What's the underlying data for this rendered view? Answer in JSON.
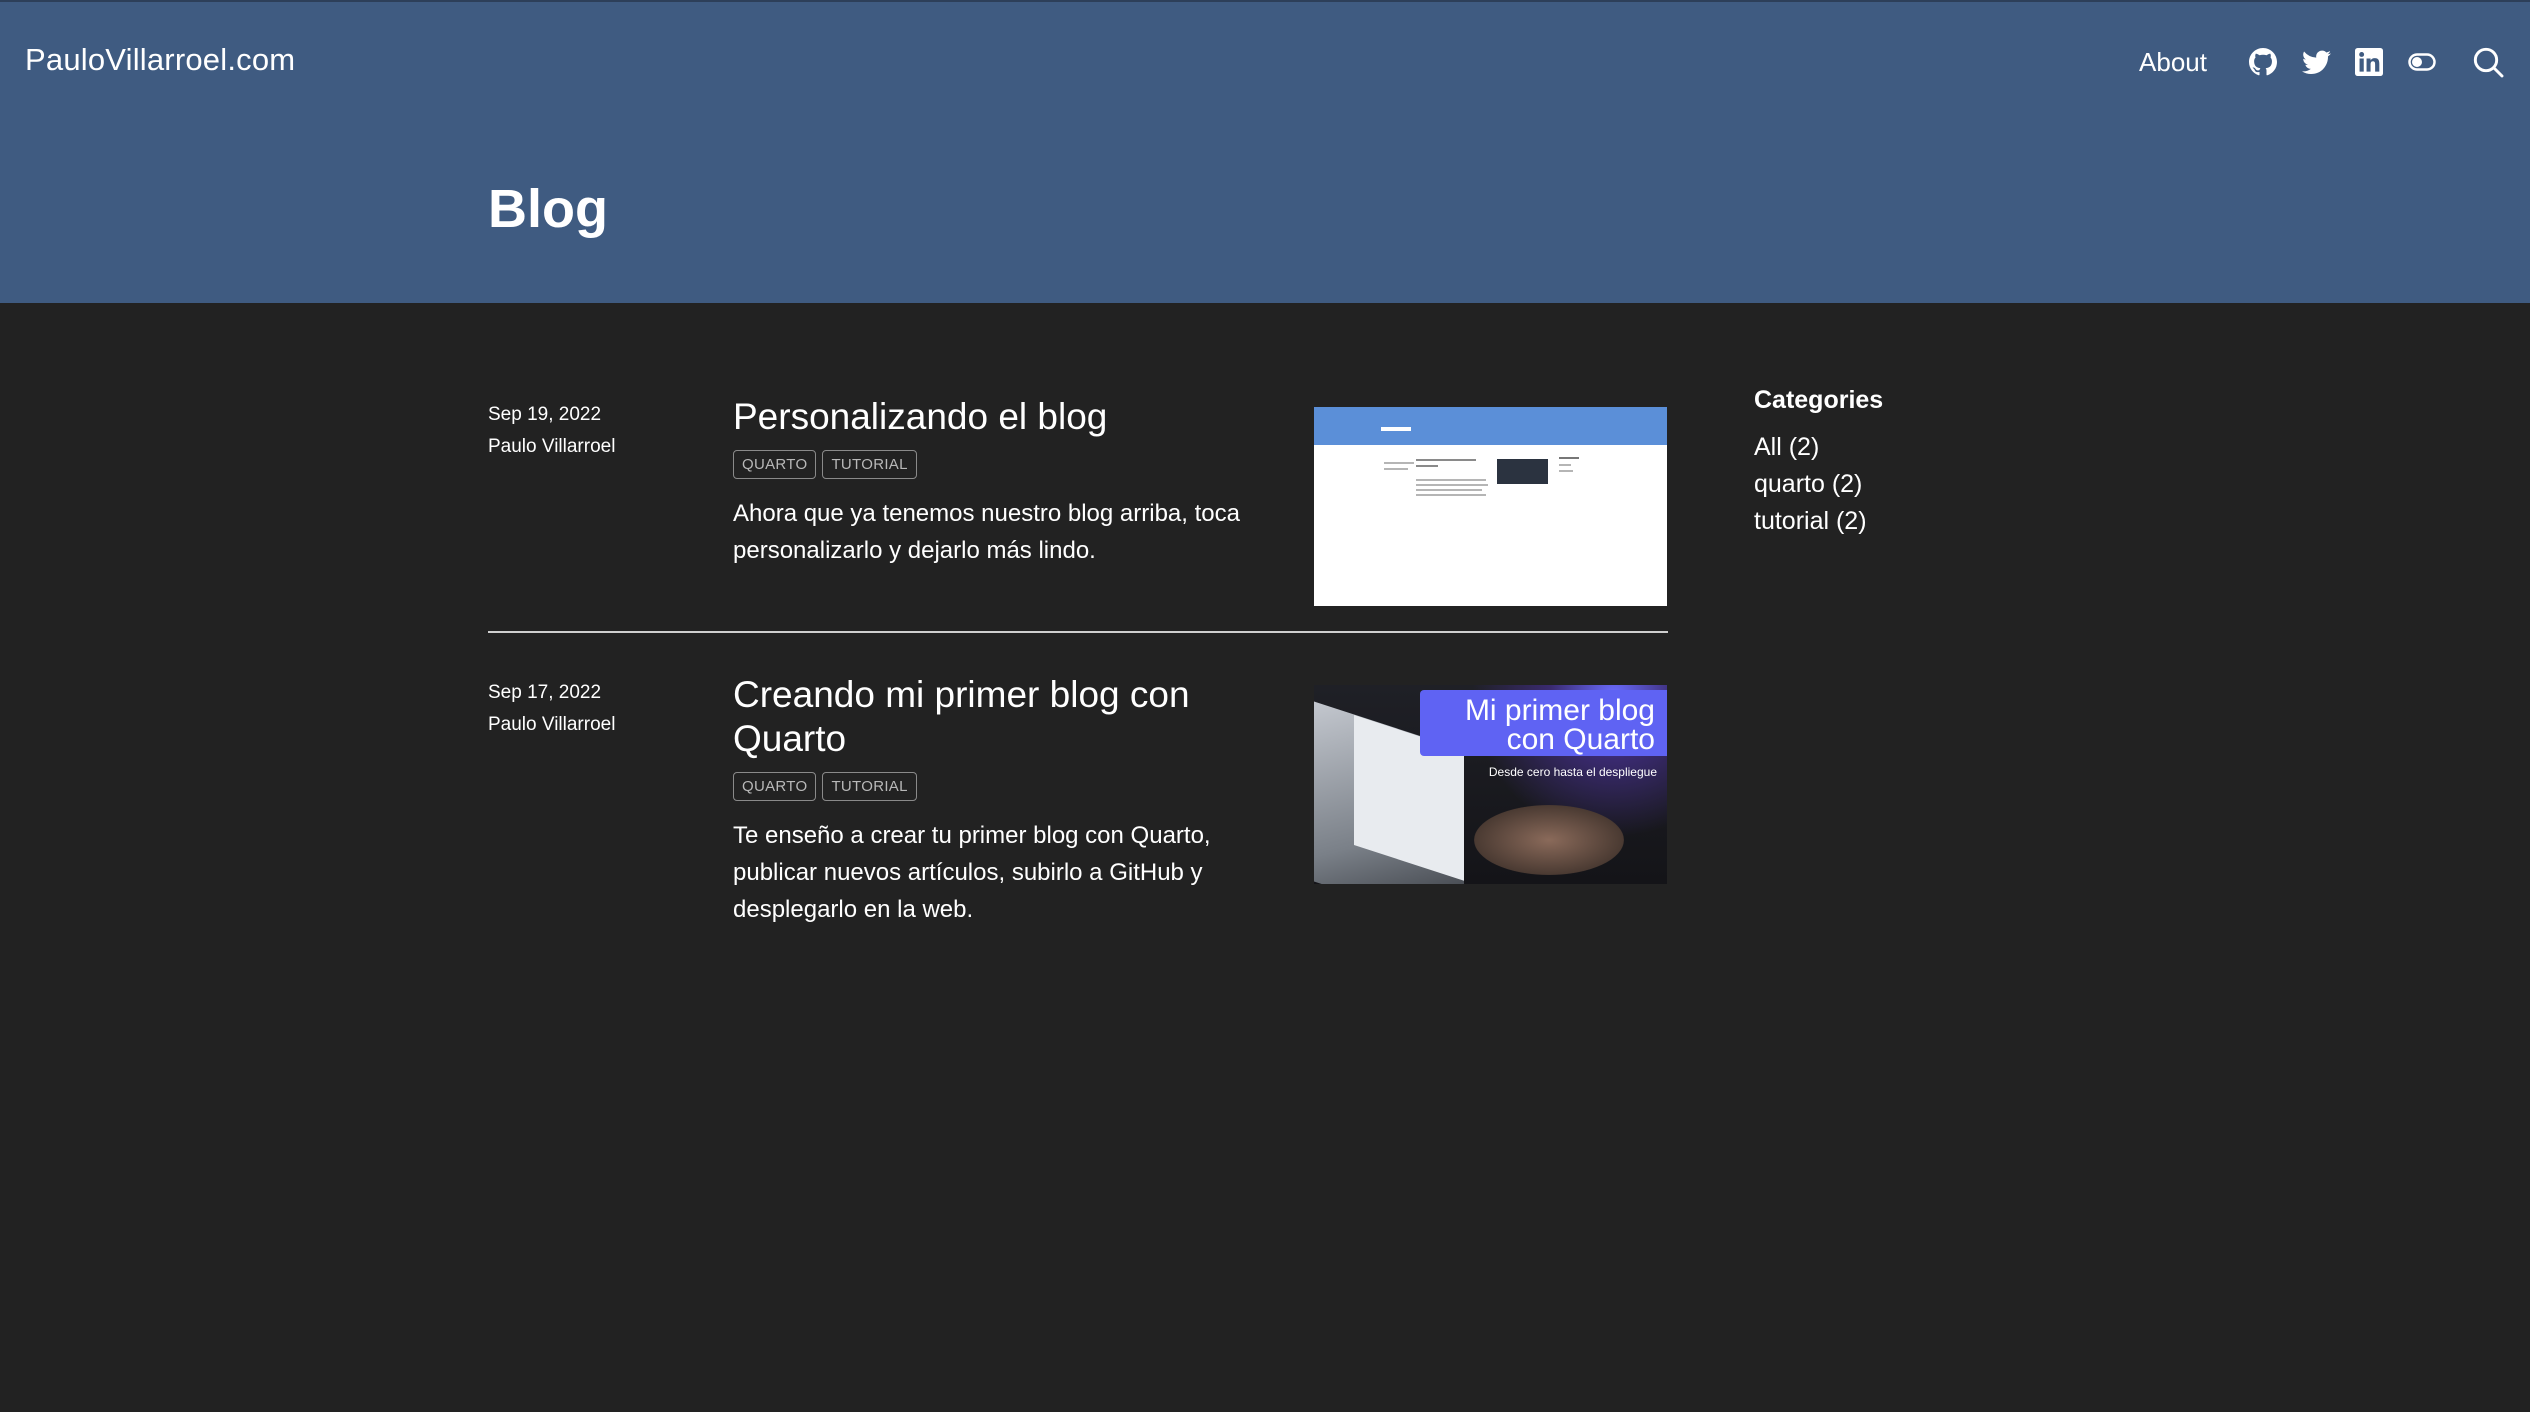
{
  "site": {
    "brand": "PauloVillarroel.com"
  },
  "nav": {
    "about_label": "About",
    "icons": [
      "github-icon",
      "twitter-icon",
      "linkedin-icon",
      "toggle-theme-icon",
      "search-icon"
    ]
  },
  "header": {
    "title": "Blog",
    "background": "#3f5b81"
  },
  "posts": [
    {
      "date": "Sep 19, 2022",
      "author": "Paulo Villarroel",
      "title": "Personalizando el blog",
      "tags": [
        "QUARTO",
        "TUTORIAL"
      ],
      "description": "Ahora que ya tenemos nuestro blog arriba, toca personalizarlo y dejarlo más lindo.",
      "thumbnail": {
        "label": "mi_blog"
      }
    },
    {
      "date": "Sep 17, 2022",
      "author": "Paulo Villarroel",
      "title": "Creando mi primer blog con Quarto",
      "tags": [
        "QUARTO",
        "TUTORIAL"
      ],
      "description": "Te enseño a crear tu primer blog con Quarto, publicar nuevos artículos, subirlo a GitHub y desplegarlo en la web.",
      "thumbnail": {
        "title_line1": "Mi primer blog",
        "title_line2": "con Quarto",
        "subtitle": "Desde cero hasta el despliegue"
      }
    }
  ],
  "sidebar": {
    "title": "Categories",
    "categories": [
      "All (2)",
      "quarto (2)",
      "tutorial (2)"
    ]
  },
  "colors": {
    "page_background": "#222222",
    "thumbnail_banner": "#5f63f3"
  }
}
